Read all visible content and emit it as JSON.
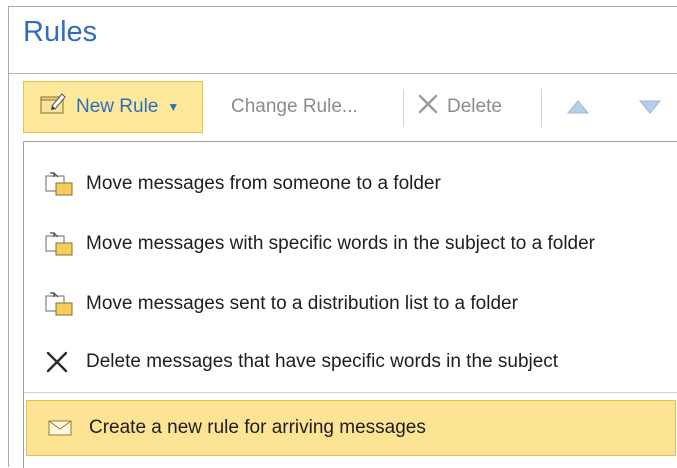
{
  "window": {
    "title": "Rules"
  },
  "toolbar": {
    "new_rule_label": "New Rule",
    "change_rule_label": "Change Rule...",
    "delete_label": "Delete",
    "move_up_icon": "arrow-up-icon",
    "move_down_icon": "arrow-down-icon"
  },
  "menu": {
    "items": [
      {
        "label": "Move messages from someone to a folder",
        "icon": "rule-folder-icon"
      },
      {
        "label": "Move messages with specific words in the subject to a folder",
        "icon": "rule-folder-icon"
      },
      {
        "label": "Move messages sent to a distribution list to a folder",
        "icon": "rule-folder-icon"
      },
      {
        "label": "Delete messages that have specific words in the subject",
        "icon": "delete-x-icon"
      },
      {
        "label": "Create a new rule for arriving messages",
        "icon": "envelope-icon",
        "highlighted": true
      }
    ]
  },
  "colors": {
    "title": "#2e6ec0",
    "highlight_bg": "#fde494",
    "highlight_border": "#e8c14f"
  }
}
